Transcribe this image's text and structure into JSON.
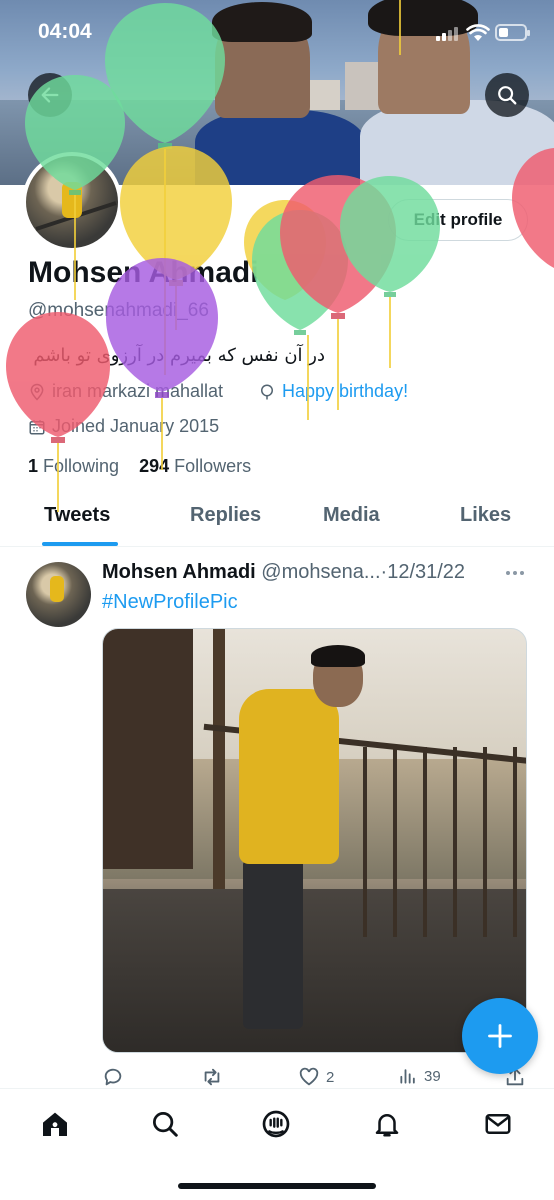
{
  "status_bar": {
    "time": "04:04"
  },
  "profile": {
    "name": "Mohsen Ahmadi",
    "handle": "@mohsenahmadi_66",
    "bio": "در آن نفس که بمیرم در آرزوی تو باشم",
    "location": "iran markazi mahallat",
    "birthday_label": "Happy birthday!",
    "joined": "Joined January 2015",
    "following_count": "1",
    "following_label": "Following",
    "followers_count": "294",
    "followers_label": "Followers",
    "edit_button": "Edit profile"
  },
  "tabs": [
    {
      "label": "Tweets",
      "active": true
    },
    {
      "label": "Replies",
      "active": false
    },
    {
      "label": "Media",
      "active": false
    },
    {
      "label": "Likes",
      "active": false
    }
  ],
  "tweet": {
    "author_name": "Mohsen Ahmadi",
    "author_handle": "@mohsena...",
    "separator": "·",
    "date": "12/31/22",
    "text": "#NewProfilePic",
    "like_count": "2",
    "view_count": "39"
  },
  "icons": {
    "back": "arrow-left-icon",
    "search": "search-icon",
    "location": "location-pin-icon",
    "birthday": "balloon-icon",
    "calendar": "calendar-icon",
    "more": "more-horizontal-icon",
    "reply": "reply-icon",
    "retweet": "retweet-icon",
    "like": "heart-icon",
    "views": "views-icon",
    "share": "share-icon",
    "compose": "plus-icon",
    "nav": [
      "home-icon",
      "search-icon",
      "spaces-icon",
      "notifications-icon",
      "messages-icon"
    ]
  },
  "colors": {
    "accent": "#1d9bf0",
    "text_primary": "#0f1419",
    "text_secondary": "#536471",
    "balloon_green": "#6fdc9c",
    "balloon_yellow": "#f2cf3a",
    "balloon_red": "#ef5b6e",
    "balloon_purple": "#a65be0"
  }
}
